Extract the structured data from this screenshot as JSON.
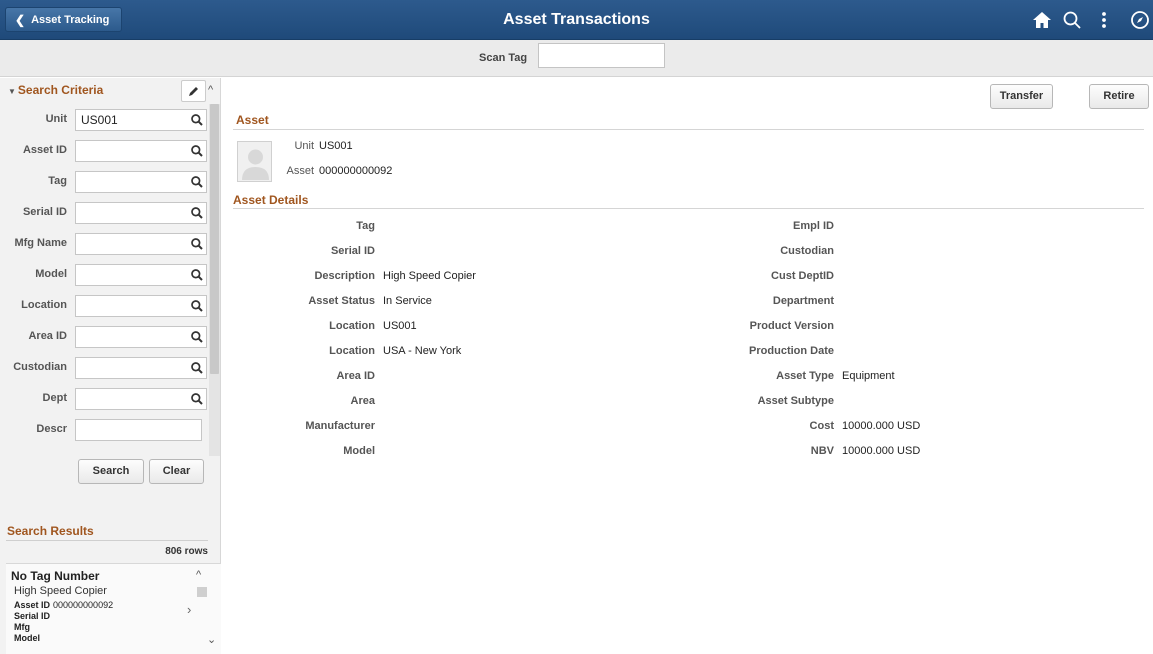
{
  "header": {
    "back_label": "Asset Tracking",
    "title": "Asset Transactions",
    "icons": [
      "home-icon",
      "search-icon",
      "more-actions-icon",
      "navbar-compass-icon"
    ]
  },
  "scan": {
    "label": "Scan Tag",
    "value": ""
  },
  "search_criteria": {
    "title": "Search Criteria",
    "fields": [
      {
        "label": "Unit",
        "value": "US001",
        "lookup": true
      },
      {
        "label": "Asset ID",
        "value": "",
        "lookup": true
      },
      {
        "label": "Tag",
        "value": "",
        "lookup": true
      },
      {
        "label": "Serial ID",
        "value": "",
        "lookup": true
      },
      {
        "label": "Mfg Name",
        "value": "",
        "lookup": true
      },
      {
        "label": "Model",
        "value": "",
        "lookup": true
      },
      {
        "label": "Location",
        "value": "",
        "lookup": true
      },
      {
        "label": "Area ID",
        "value": "",
        "lookup": true
      },
      {
        "label": "Custodian",
        "value": "",
        "lookup": true
      },
      {
        "label": "Dept",
        "value": "",
        "lookup": true
      },
      {
        "label": "Descr",
        "value": "",
        "lookup": false
      }
    ],
    "search_label": "Search",
    "clear_label": "Clear"
  },
  "search_results": {
    "title": "Search Results",
    "rows_count": "806 rows",
    "item": {
      "tag": "No Tag Number",
      "description": "High Speed Copier",
      "asset_id_label": "Asset ID",
      "asset_id_value": "000000000092",
      "serial_label": "Serial ID",
      "mfg_label": "Mfg",
      "model_label": "Model"
    }
  },
  "main": {
    "transfer_label": "Transfer",
    "retire_label": "Retire",
    "asset_section": "Asset",
    "unit_label": "Unit",
    "unit_value": "US001",
    "asset_label": "Asset",
    "asset_value": "000000000092",
    "details_section": "Asset Details",
    "left_details": [
      {
        "label": "Tag",
        "value": ""
      },
      {
        "label": "Serial ID",
        "value": ""
      },
      {
        "label": "Description",
        "value": "High Speed Copier"
      },
      {
        "label": "Asset Status",
        "value": "In Service"
      },
      {
        "label": "Location",
        "value": "US001"
      },
      {
        "label": "Location",
        "value": "USA - New York"
      },
      {
        "label": "Area ID",
        "value": ""
      },
      {
        "label": "Area",
        "value": ""
      },
      {
        "label": "Manufacturer",
        "value": ""
      },
      {
        "label": "Model",
        "value": ""
      }
    ],
    "right_details": [
      {
        "label": "Empl ID",
        "value": ""
      },
      {
        "label": "Custodian",
        "value": ""
      },
      {
        "label": "Cust DeptID",
        "value": ""
      },
      {
        "label": "Department",
        "value": ""
      },
      {
        "label": "Product Version",
        "value": ""
      },
      {
        "label": "Production Date",
        "value": ""
      },
      {
        "label": "Asset Type",
        "value": "Equipment"
      },
      {
        "label": "Asset Subtype",
        "value": ""
      },
      {
        "label": "Cost",
        "value": "10000.000  USD"
      },
      {
        "label": "NBV",
        "value": "10000.000  USD"
      }
    ]
  }
}
